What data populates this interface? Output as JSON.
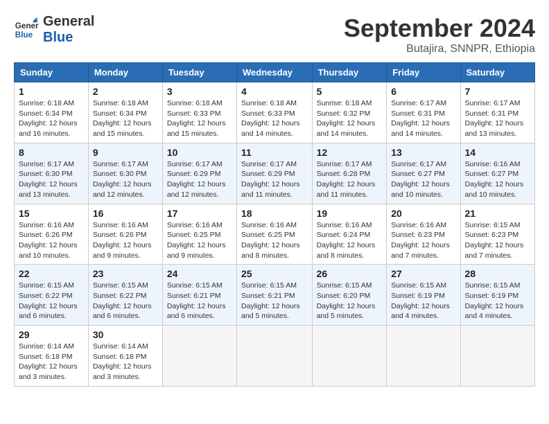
{
  "header": {
    "logo_line1": "General",
    "logo_line2": "Blue",
    "month": "September 2024",
    "location": "Butajira, SNNPR, Ethiopia"
  },
  "days_of_week": [
    "Sunday",
    "Monday",
    "Tuesday",
    "Wednesday",
    "Thursday",
    "Friday",
    "Saturday"
  ],
  "weeks": [
    {
      "alt": false,
      "days": [
        {
          "num": "1",
          "info": "Sunrise: 6:18 AM\nSunset: 6:34 PM\nDaylight: 12 hours\nand 16 minutes."
        },
        {
          "num": "2",
          "info": "Sunrise: 6:18 AM\nSunset: 6:34 PM\nDaylight: 12 hours\nand 15 minutes."
        },
        {
          "num": "3",
          "info": "Sunrise: 6:18 AM\nSunset: 6:33 PM\nDaylight: 12 hours\nand 15 minutes."
        },
        {
          "num": "4",
          "info": "Sunrise: 6:18 AM\nSunset: 6:33 PM\nDaylight: 12 hours\nand 14 minutes."
        },
        {
          "num": "5",
          "info": "Sunrise: 6:18 AM\nSunset: 6:32 PM\nDaylight: 12 hours\nand 14 minutes."
        },
        {
          "num": "6",
          "info": "Sunrise: 6:17 AM\nSunset: 6:31 PM\nDaylight: 12 hours\nand 14 minutes."
        },
        {
          "num": "7",
          "info": "Sunrise: 6:17 AM\nSunset: 6:31 PM\nDaylight: 12 hours\nand 13 minutes."
        }
      ]
    },
    {
      "alt": true,
      "days": [
        {
          "num": "8",
          "info": "Sunrise: 6:17 AM\nSunset: 6:30 PM\nDaylight: 12 hours\nand 13 minutes."
        },
        {
          "num": "9",
          "info": "Sunrise: 6:17 AM\nSunset: 6:30 PM\nDaylight: 12 hours\nand 12 minutes."
        },
        {
          "num": "10",
          "info": "Sunrise: 6:17 AM\nSunset: 6:29 PM\nDaylight: 12 hours\nand 12 minutes."
        },
        {
          "num": "11",
          "info": "Sunrise: 6:17 AM\nSunset: 6:29 PM\nDaylight: 12 hours\nand 11 minutes."
        },
        {
          "num": "12",
          "info": "Sunrise: 6:17 AM\nSunset: 6:28 PM\nDaylight: 12 hours\nand 11 minutes."
        },
        {
          "num": "13",
          "info": "Sunrise: 6:17 AM\nSunset: 6:27 PM\nDaylight: 12 hours\nand 10 minutes."
        },
        {
          "num": "14",
          "info": "Sunrise: 6:16 AM\nSunset: 6:27 PM\nDaylight: 12 hours\nand 10 minutes."
        }
      ]
    },
    {
      "alt": false,
      "days": [
        {
          "num": "15",
          "info": "Sunrise: 6:16 AM\nSunset: 6:26 PM\nDaylight: 12 hours\nand 10 minutes."
        },
        {
          "num": "16",
          "info": "Sunrise: 6:16 AM\nSunset: 6:26 PM\nDaylight: 12 hours\nand 9 minutes."
        },
        {
          "num": "17",
          "info": "Sunrise: 6:16 AM\nSunset: 6:25 PM\nDaylight: 12 hours\nand 9 minutes."
        },
        {
          "num": "18",
          "info": "Sunrise: 6:16 AM\nSunset: 6:25 PM\nDaylight: 12 hours\nand 8 minutes."
        },
        {
          "num": "19",
          "info": "Sunrise: 6:16 AM\nSunset: 6:24 PM\nDaylight: 12 hours\nand 8 minutes."
        },
        {
          "num": "20",
          "info": "Sunrise: 6:16 AM\nSunset: 6:23 PM\nDaylight: 12 hours\nand 7 minutes."
        },
        {
          "num": "21",
          "info": "Sunrise: 6:15 AM\nSunset: 6:23 PM\nDaylight: 12 hours\nand 7 minutes."
        }
      ]
    },
    {
      "alt": true,
      "days": [
        {
          "num": "22",
          "info": "Sunrise: 6:15 AM\nSunset: 6:22 PM\nDaylight: 12 hours\nand 6 minutes."
        },
        {
          "num": "23",
          "info": "Sunrise: 6:15 AM\nSunset: 6:22 PM\nDaylight: 12 hours\nand 6 minutes."
        },
        {
          "num": "24",
          "info": "Sunrise: 6:15 AM\nSunset: 6:21 PM\nDaylight: 12 hours\nand 6 minutes."
        },
        {
          "num": "25",
          "info": "Sunrise: 6:15 AM\nSunset: 6:21 PM\nDaylight: 12 hours\nand 5 minutes."
        },
        {
          "num": "26",
          "info": "Sunrise: 6:15 AM\nSunset: 6:20 PM\nDaylight: 12 hours\nand 5 minutes."
        },
        {
          "num": "27",
          "info": "Sunrise: 6:15 AM\nSunset: 6:19 PM\nDaylight: 12 hours\nand 4 minutes."
        },
        {
          "num": "28",
          "info": "Sunrise: 6:15 AM\nSunset: 6:19 PM\nDaylight: 12 hours\nand 4 minutes."
        }
      ]
    },
    {
      "alt": false,
      "days": [
        {
          "num": "29",
          "info": "Sunrise: 6:14 AM\nSunset: 6:18 PM\nDaylight: 12 hours\nand 3 minutes."
        },
        {
          "num": "30",
          "info": "Sunrise: 6:14 AM\nSunset: 6:18 PM\nDaylight: 12 hours\nand 3 minutes."
        },
        {
          "num": "",
          "info": ""
        },
        {
          "num": "",
          "info": ""
        },
        {
          "num": "",
          "info": ""
        },
        {
          "num": "",
          "info": ""
        },
        {
          "num": "",
          "info": ""
        }
      ]
    }
  ]
}
